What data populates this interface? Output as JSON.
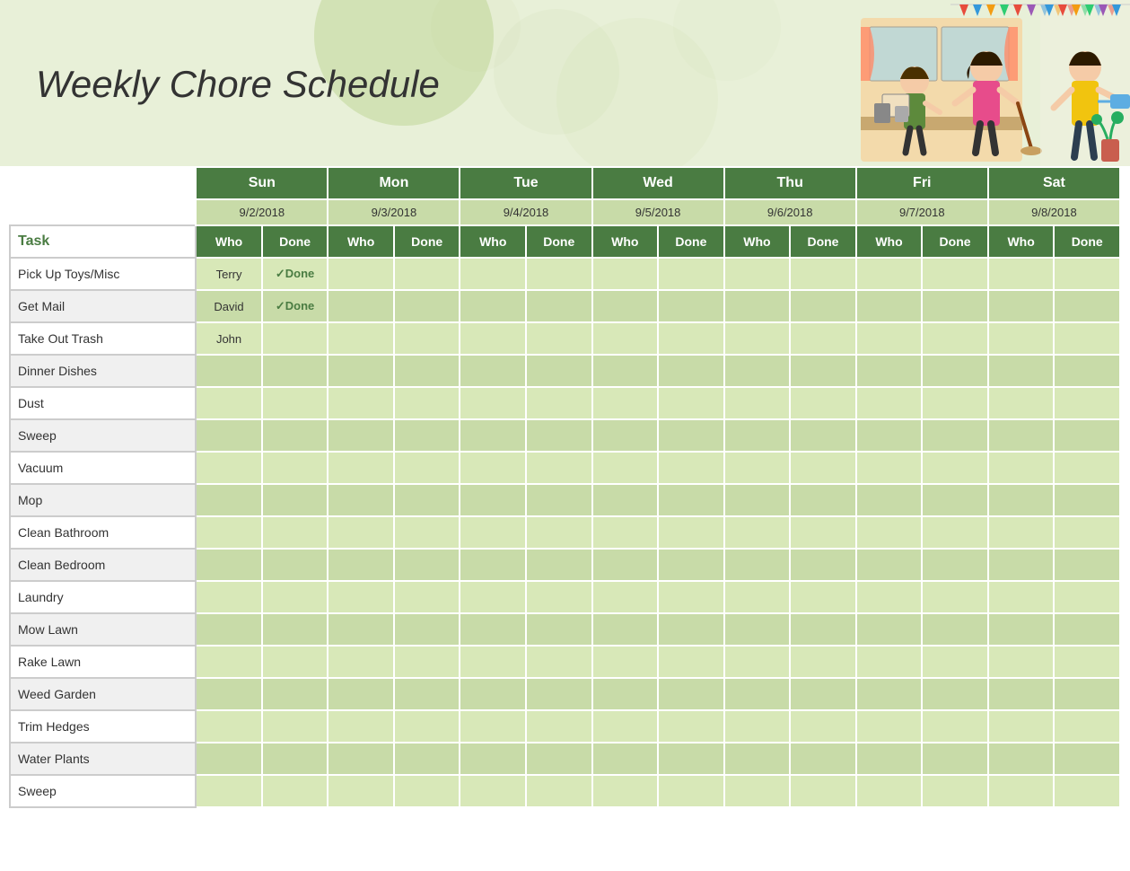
{
  "header": {
    "title": "Weekly Chore Schedule",
    "bg_color": "#e8f0d8"
  },
  "days": [
    {
      "name": "Sun",
      "date": "9/2/2018"
    },
    {
      "name": "Mon",
      "date": "9/3/2018"
    },
    {
      "name": "Tue",
      "date": "9/4/2018"
    },
    {
      "name": "Wed",
      "date": "9/5/2018"
    },
    {
      "name": "Thu",
      "date": "9/6/2018"
    },
    {
      "name": "Fri",
      "date": "9/7/2018"
    },
    {
      "name": "Sat",
      "date": "9/8/2018"
    }
  ],
  "col_headers": {
    "task": "Task",
    "who": "Who",
    "done": "Done"
  },
  "tasks": [
    {
      "name": "Pick Up Toys/Misc",
      "sun_who": "Terry",
      "sun_done": "✓Done"
    },
    {
      "name": "Get Mail",
      "sun_who": "David",
      "sun_done": "✓Done"
    },
    {
      "name": "Take Out Trash",
      "sun_who": "John",
      "sun_done": ""
    },
    {
      "name": "Dinner Dishes"
    },
    {
      "name": "Dust"
    },
    {
      "name": "Sweep"
    },
    {
      "name": "Vacuum"
    },
    {
      "name": "Mop"
    },
    {
      "name": "Clean Bathroom"
    },
    {
      "name": "Clean Bedroom"
    },
    {
      "name": "Laundry"
    },
    {
      "name": "Mow Lawn"
    },
    {
      "name": "Rake Lawn"
    },
    {
      "name": "Weed Garden"
    },
    {
      "name": "Trim Hedges"
    },
    {
      "name": "Water Plants"
    },
    {
      "name": "Sweep"
    }
  ]
}
